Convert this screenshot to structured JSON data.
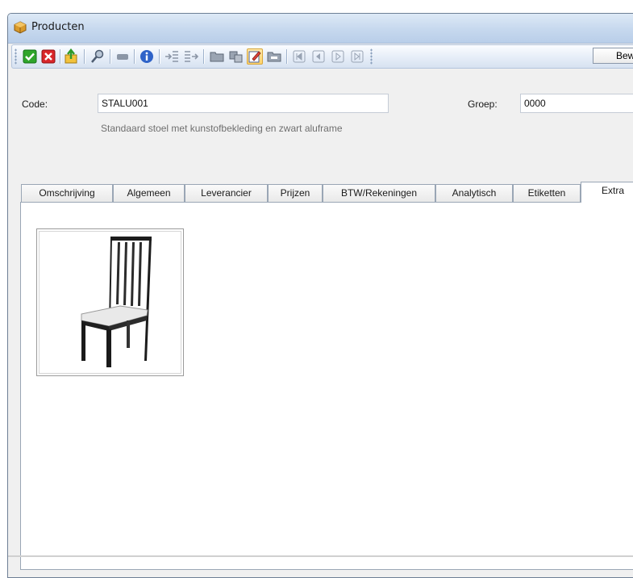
{
  "window": {
    "title": "Producten",
    "icon": "package-icon"
  },
  "toolbar": {
    "buttons": [
      {
        "name": "ok-icon",
        "color": "#2fa52b"
      },
      {
        "name": "cancel-icon",
        "color": "#d9262a"
      },
      {
        "name": "export-icon"
      },
      {
        "name": "search-icon"
      },
      {
        "name": "minus-icon"
      },
      {
        "name": "info-icon"
      },
      {
        "name": "indent-icon"
      },
      {
        "name": "outdent-icon"
      },
      {
        "name": "open-folder-icon"
      },
      {
        "name": "copy-icon"
      },
      {
        "name": "edit-icon"
      },
      {
        "name": "folder-icon"
      },
      {
        "name": "first-record-icon"
      },
      {
        "name": "previous-record-icon"
      },
      {
        "name": "next-record-icon"
      },
      {
        "name": "last-record-icon"
      }
    ],
    "edit_label": "Bew"
  },
  "form": {
    "code_label": "Code:",
    "code_value": "STALU001",
    "groep_label": "Groep:",
    "groep_value": "0000",
    "description": "Standaard stoel met kunstofbekleding en zwart aluframe"
  },
  "tabs": [
    {
      "label": "Omschrijving"
    },
    {
      "label": "Algemeen"
    },
    {
      "label": "Leverancier"
    },
    {
      "label": "Prijzen"
    },
    {
      "label": "BTW/Rekeningen"
    },
    {
      "label": "Analytisch"
    },
    {
      "label": "Etiketten"
    },
    {
      "label": "Extra",
      "active": true
    }
  ],
  "extra": {
    "image": "chair-image"
  }
}
